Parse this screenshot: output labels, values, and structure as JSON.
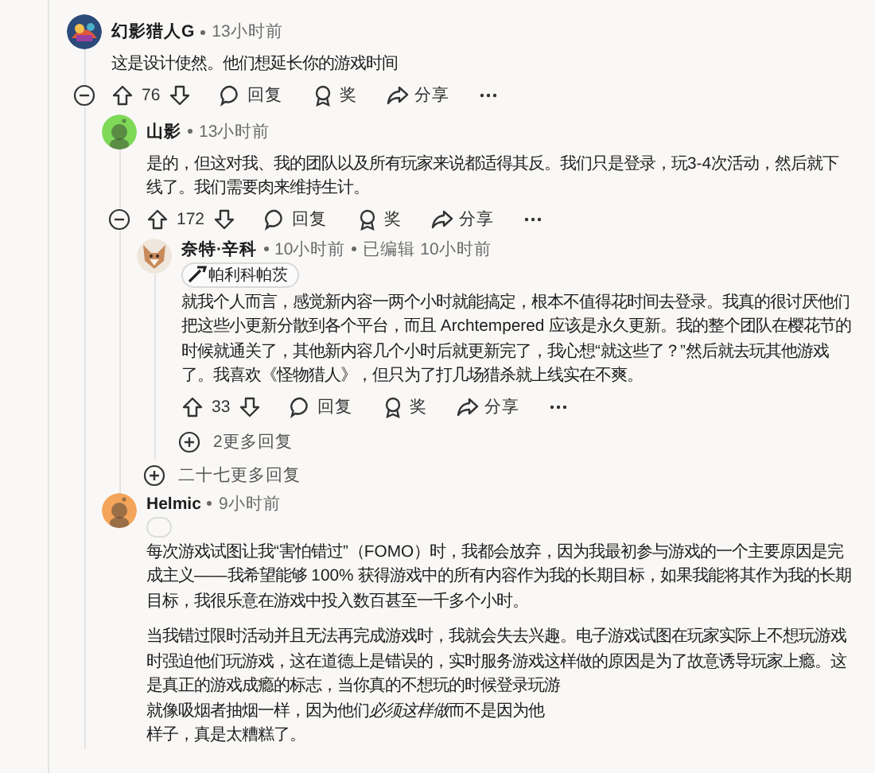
{
  "comments": [
    {
      "author": "幻影猎人G",
      "time": "13小时前",
      "avatar": {
        "kind": "art"
      },
      "expanded": true,
      "paragraphs": [
        {
          "text": "这是设计使然。他们想延长你的游戏时间"
        }
      ],
      "votes": "76",
      "actions": [
        "回复",
        "奖",
        "分享"
      ],
      "children": [
        {
          "author": "山影",
          "time": "13小时前",
          "avatar": {
            "kind": "snoo",
            "color": "#7ed957"
          },
          "expanded": true,
          "paragraphs": [
            {
              "text": "是的，但这对我、我的团队以及所有玩家来说都适得其反。我们只是登录，玩3-4次活动，然后就下线了。我们需要肉来维持生计。"
            }
          ],
          "votes": "172",
          "actions": [
            "回复",
            "奖",
            "分享"
          ],
          "children": [
            {
              "author": "奈特·辛科",
              "time": "10小时前",
              "edited": "已编辑 10小时前",
              "flair": "帕利科帕茨",
              "avatar": {
                "kind": "fox"
              },
              "paragraphs": [
                {
                  "text": "就我个人而言，感觉新内容一两个小时就能搞定，根本不值得花时间去登录。我真的很讨厌他们把这些小更新分散到各个平台，而且 Archtempered 应该是永久更新。我的整个团队在樱花节的时候就通关了，其他新内容几个小时后就更新完了，我心想“就这些了？”然后就去玩其他游戏了。我喜欢《怪物猎人》，但只为了打几场猎杀就上线实在不爽。"
                }
              ],
              "votes": "33",
              "actions": [
                "回复",
                "奖",
                "分享"
              ],
              "more_replies": "2更多回复"
            }
          ],
          "more_replies": "二十七更多回复"
        },
        {
          "author": "Helmic",
          "time": "9小时前",
          "avatar": {
            "kind": "snoo",
            "color": "#f5a55a"
          },
          "blank_flair": true,
          "paragraphs": [
            {
              "text": "每次游戏试图让我“害怕错过”（FOMO）时，我都会放弃，因为我最初参与游戏的一个主要原因是完成主义——我希望能够 100% 获得游戏中的所有内容作为我的长期目标，如果我能将其作为我的长期目标，我很乐意在游戏中投入数百甚至一千多个小时。"
            },
            {
              "lines": [
                "当我错过限时活动并且无法再完成游戏时，我就会失去兴趣。电子游戏试图在玩家实际上不想玩游戏",
                "时强迫他们玩游戏，这在道德上是错误的，实时服务游戏这样做的原因是为了故意诱导玩家上瘾。这",
                "是真正的游戏成瘾的标志，当你真的不想玩的时候登录玩游",
                {
                  "parts": [
                    {
                      "text": "就像吸烟者抽烟一样，因为他们",
                      "italic": false
                    },
                    {
                      "text": "必须这样做",
                      "italic": true
                    },
                    {
                      "text": "而不是因为他",
                      "italic": false
                    }
                  ]
                },
                "样子，真是太糟糕了。"
              ]
            }
          ]
        }
      ]
    }
  ]
}
